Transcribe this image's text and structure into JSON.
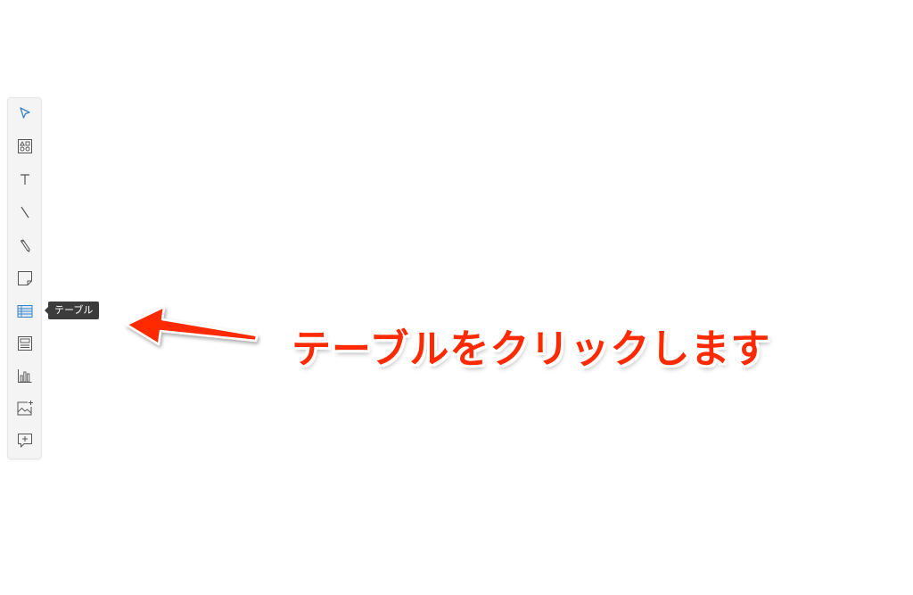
{
  "toolbar": {
    "tools": [
      {
        "name": "select-tool",
        "icon": "cursor-arrow-icon",
        "active": true
      },
      {
        "name": "shapes-tool",
        "icon": "shapes-icon"
      },
      {
        "name": "text-tool",
        "icon": "text-icon"
      },
      {
        "name": "line-tool",
        "icon": "line-icon"
      },
      {
        "name": "pen-tool",
        "icon": "pencil-icon"
      },
      {
        "name": "sticky-note-tool",
        "icon": "sticky-note-icon"
      },
      {
        "name": "table-tool",
        "icon": "table-icon",
        "highlighted": true
      },
      {
        "name": "card-tool",
        "icon": "card-icon"
      },
      {
        "name": "chart-tool",
        "icon": "bar-chart-icon"
      },
      {
        "name": "image-tool",
        "icon": "image-add-icon"
      },
      {
        "name": "comment-tool",
        "icon": "comment-add-icon"
      }
    ],
    "tooltip": "テーブル"
  },
  "annotation": {
    "text": "テーブルをクリックします",
    "color": "#ff2a00"
  },
  "colors": {
    "accent": "#3b82c4",
    "icon": "#555555",
    "tooltip_bg": "#3c3c3c"
  }
}
